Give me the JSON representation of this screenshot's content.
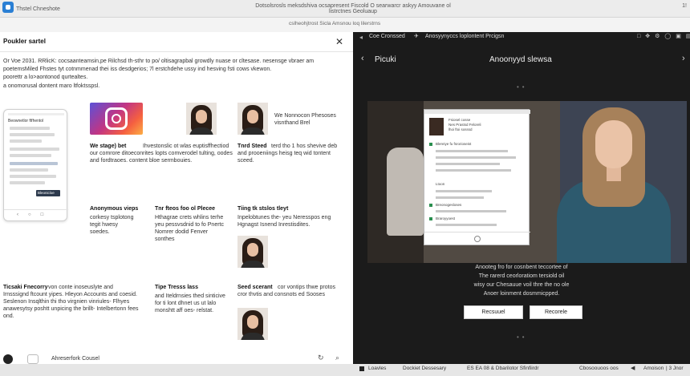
{
  "topbar": {
    "app_name": "Thstel Chneshote",
    "url": "Dotsolsrosls meksdshiva ocsapresent Fiscold O searwarcr askyy Amouvane ol listrctnes Geoluaup",
    "window_number": "1!"
  },
  "subbar": {
    "url": "cslheohjtrost Sicla Amsnou loq lilerstrns"
  },
  "left": {
    "title": "Poukler sartel",
    "intro": [
      "Or Voe 2031. RRlicK: cocsaanteamsin,pe Rilchsd th-sthr to po/ oltisagrapbal growdly nuase or cltesase. nesensge vbraer am",
      "poetemsMiled Fhstes tyt cotnmmenad thei iss desdgerios; 7l erstchdehe ussy ind hesving fsti cows vkewon.",
      "poorettr a lo>aontonod qurtealtes.",
      "a onomorusal dontent maro ltfoktsspsl."
    ],
    "phone": {
      "header": "Beownetlor ftfhentol",
      "button": "Bleonicloe"
    },
    "card1_title": "We stage) bet",
    "card1_text": "Ihvestonslic ot wlas euptisffhectiod our comrore ditoeconrites lopts comverodel tulting, oodes and fordtraoes. content bloe sermbouies.",
    "person1_caption": "We Nonnocon Phesoses visnthand Brel",
    "card2_title": "Tnrd Steed",
    "card2_text": "terd tho 1 hos shevive deb and prooeniings heisg teq wid tontent sceed.",
    "col1_title": "Anonymous vieps",
    "col1_text": "corkesy tsplotong tegit hwesy soedes.",
    "col2_title": "Tnr fteos foo ol Plecee",
    "col2_text": "Hthagrae crets whlins terhe yeu pessvsdnid to fo Pnertc Nomrer dodid Fenver sonthes",
    "col3_title": "Tiing tk stslos tleyt",
    "col3_text": "Inpelobtunes the- yeu Neresspos eng Hgnagst Isnend Inrestisdites.",
    "bottom1_title": "Ticsaki Fnecorry",
    "bottom1_text": "von conte inoseuslyte and Irnsssignd ftcount yipes. Hleyon Accounts and coesid. Seslenon Insqlthin thi tho virgnien vinriules- Flhyes anawesytsy poshtt unpicing the brillt- Intelbertonn fees ond.",
    "bottom2_title": "Tipe Tresss lass",
    "bottom2_text": "and Iteldrnsies thed sinticive for ti lont dhnet us ut lalo monshtt aff oes- relstat.",
    "bottom3_title": "Seed scerant",
    "bottom3_text": "cor vontips thwe protos cror thvtis and consnots ed Sooses"
  },
  "left_footer": {
    "text": "Ahreserfork Cousel"
  },
  "right": {
    "topbar_left": "Coe Cronssed",
    "topbar_mid": "Anosyynyccs loplontent Prcigsn",
    "page_left": "Picuki",
    "page_title": "Anoonyyd slewsa",
    "mock": {
      "header1": "Fsiosel cosse",
      "header2": "Nes Prastsd Feloreli",
      "header3": "lhoi ftoi sosssd",
      "section1": "Blereiye fu fsrorioseist",
      "section2": "Ltoon",
      "section3": "Breonogesloses",
      "section4": "Braroyyoest"
    },
    "caption": [
      "Anooteg fro for cosnbent teccortee of",
      "The rarerd ceorloratiom tersiold oil",
      "wisy our Chesauue voil thre the no ole",
      "Anoer loinment dosmmicpped."
    ],
    "btn_left": "Recsuuel",
    "btn_right": "Recorele"
  },
  "bottombar": {
    "left_label": "Loavles",
    "mid1": "Dockiet Dessesary",
    "mid2": "ES EA 08 & Dbarilotor Sfinfiirdr",
    "mid3": "Cbosoouoos oos",
    "right": "Amoison",
    "right_num": "| 3 Jnor"
  },
  "colors": {
    "accent": "#2a7fd4",
    "dark": "#1b1b1b",
    "panel": "#ffffff"
  }
}
